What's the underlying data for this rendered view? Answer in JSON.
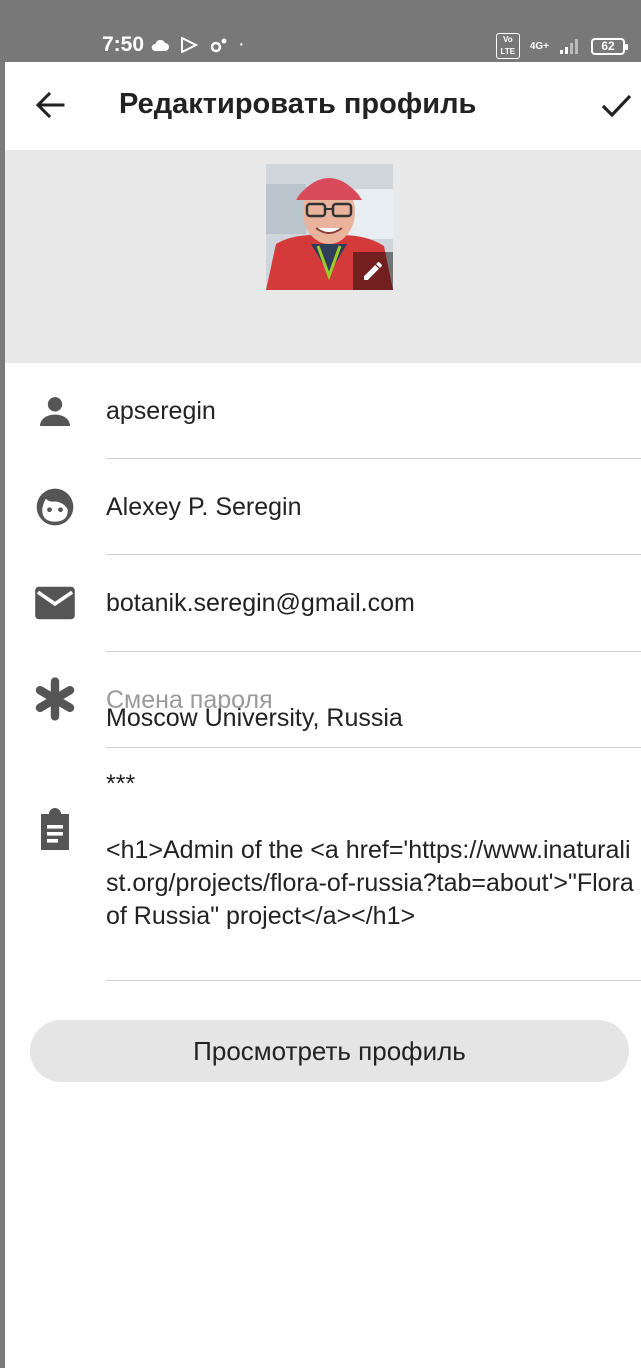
{
  "status_bar": {
    "time": "7:50",
    "network": "4G+",
    "vo_lte": "Vo LTE",
    "battery": "62"
  },
  "appbar": {
    "title": "Редактировать профиль",
    "back_icon": "arrow-back-icon",
    "save_icon": "check-icon"
  },
  "profile": {
    "avatar_alt": "profile photo",
    "edit_icon": "pencil-icon"
  },
  "fields": {
    "username": {
      "icon": "person-icon",
      "value": "apseregin"
    },
    "name": {
      "icon": "face-icon",
      "value": "Alexey P. Seregin"
    },
    "email": {
      "icon": "mail-icon",
      "value": "botanik.seregin@gmail.com"
    },
    "password": {
      "icon": "asterisk-icon",
      "placeholder": "Смена пароля"
    },
    "bio": {
      "icon": "clipboard-icon",
      "value": "Moscow University, Russia\n\n***\n\n<h1>Admin of the <a href='https://www.inaturalist.org/projects/flora-of-russia?tab=about'>\"Flora of Russia\" project</a></h1>"
    }
  },
  "view_profile_button": "Просмотреть профиль",
  "colors": {
    "icon": "#555555",
    "placeholder": "#9a9a9a",
    "button_bg": "#e5e5e5",
    "photo_band_bg": "#e8e8e8"
  }
}
